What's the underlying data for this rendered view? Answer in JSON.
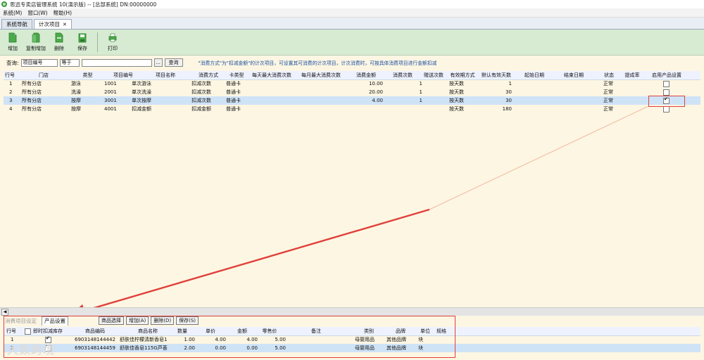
{
  "window": {
    "title": "思迅专卖店管理系统 10(演示版) -- [总部系统] DN:00000000"
  },
  "menu": [
    "系统(M)",
    "窗口(W)",
    "帮助(H)"
  ],
  "tabs": [
    {
      "label": "系统导航"
    },
    {
      "label": "计次项目",
      "close": "✕"
    }
  ],
  "toolbar": {
    "add": "增加",
    "copy_add": "复制增加",
    "delete": "删除",
    "save": "保存",
    "print": "打印"
  },
  "query": {
    "label": "查询:",
    "field": "项目编号",
    "operator": "等于",
    "value": "",
    "ellipsis": "...",
    "button": "查询",
    "hint": "\"消费方式\"为\"扣减金额\"的计次项目，可设置其可消费的计次项目，计次消费时，可按具体消费项目进行金额扣减"
  },
  "main_table": {
    "columns": [
      "行号",
      "门店",
      "类型",
      "项目编号",
      "项目名称",
      "消费方式",
      "卡类型",
      "每天最大消费次数",
      "每月最大消费次数",
      "消费金额",
      "消费次数",
      "赠送次数",
      "有效期方式",
      "默认有效天数",
      "起始日期",
      "结束日期",
      "状态",
      "提成率",
      "启用产品设置"
    ],
    "rows": [
      {
        "no": "1",
        "store": "所有分店",
        "type": "游泳",
        "code": "1001",
        "name": "单次游泳",
        "mode": "扣减次数",
        "card": "普通卡",
        "amount": "10.00",
        "count": "1",
        "valid": "按天数",
        "days": "1",
        "status": "正常",
        "enabled": false
      },
      {
        "no": "2",
        "store": "所有分店",
        "type": "洗澡",
        "code": "2001",
        "name": "单次洗澡",
        "mode": "扣减次数",
        "card": "普通卡",
        "amount": "20.00",
        "count": "1",
        "valid": "按天数",
        "days": "30",
        "status": "正常",
        "enabled": false
      },
      {
        "no": "3",
        "store": "所有分店",
        "type": "按摩",
        "code": "3001",
        "name": "单次按摩",
        "mode": "扣减次数",
        "card": "普通卡",
        "amount": "4.00",
        "count": "1",
        "valid": "按天数",
        "days": "30",
        "status": "正常",
        "enabled": true
      },
      {
        "no": "4",
        "store": "所有分店",
        "type": "按摩",
        "code": "4001",
        "name": "扣减金额",
        "mode": "扣减金额",
        "card": "普通卡",
        "amount": "",
        "count": "",
        "valid": "按天数",
        "days": "180",
        "status": "正常",
        "enabled": false
      }
    ]
  },
  "bottom_tabs": {
    "consume_settings": "消费项目设定",
    "product_settings": "产品设置"
  },
  "bottom_buttons": {
    "select": "商品选择",
    "add": "增加(A)",
    "delete": "删除(D)",
    "save": "保存(S)"
  },
  "product_table": {
    "columns": [
      "行号",
      "即时扣减库存",
      "商品编码",
      "商品名称",
      "数量",
      "单价",
      "金额",
      "零售价",
      "备注",
      "类别",
      "品牌",
      "单位",
      "规格"
    ],
    "rows": [
      {
        "no": "1",
        "deduct": true,
        "code": "6903148144442",
        "name": "舒肤佳柠檬清新香皂1",
        "qty": "1.00",
        "price": "4.00",
        "amount": "4.00",
        "retail": "5.00",
        "category": "母婴用品",
        "brand": "其他品牌",
        "unit": "块"
      },
      {
        "no": "2",
        "deduct": false,
        "code": "6903148144459",
        "name": "舒肤佳香皂115G芦荟",
        "qty": "2.00",
        "price": "0.00",
        "amount": "0.00",
        "retail": "5.00",
        "category": "母婴用品",
        "brand": "其他品牌",
        "unit": "块"
      }
    ]
  },
  "colors": {
    "highlight_red": "#e0403a",
    "toolbar_green": "#d7ebd2",
    "selected_row": "#cfe3f7",
    "hint_blue": "#1a4fa0"
  },
  "watermark": "大数跨境"
}
